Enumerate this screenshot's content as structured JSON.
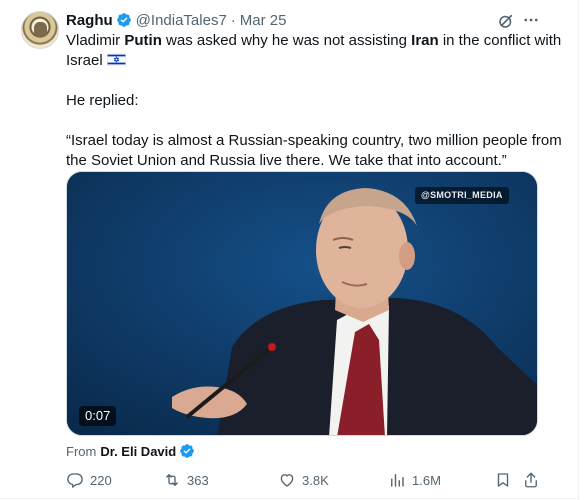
{
  "tweet": {
    "author_name": "Raghu",
    "handle": "@IndiaTales7",
    "separator": "·",
    "date": "Mar 25",
    "text_line1_a": "Vladimir ",
    "text_line1_b": "Putin",
    "text_line1_c": " was asked why he was not assisting ",
    "text_line1_d": "Iran",
    "text_line1_e": " in the conflict with",
    "text_line2": "Israel",
    "text_line3": "He replied:",
    "text_line4": "“Israel today is almost a Russian-speaking country, two million people from",
    "text_line5": "the Soviet Union and Russia live there. We take that into account.”"
  },
  "media": {
    "watermark": "@SMOTRI_MEDIA",
    "duration": "0:07"
  },
  "source": {
    "prefix": "From",
    "name": "Dr. Eli David"
  },
  "actions": {
    "replies": "220",
    "reposts": "363",
    "likes": "3.8K",
    "views": "1.6M"
  },
  "colors": {
    "verified": "#1d9bf0",
    "text": "#0f1419",
    "muted": "#536471",
    "israel_blue": "#0038b8"
  },
  "icons": {
    "verified": "verified-badge-icon",
    "grok": "grok-icon",
    "more": "more-horizontal-icon",
    "reply": "reply-icon",
    "repost": "repost-icon",
    "like": "heart-icon",
    "views": "views-bar-chart-icon",
    "bookmark": "bookmark-icon",
    "share": "share-icon"
  }
}
